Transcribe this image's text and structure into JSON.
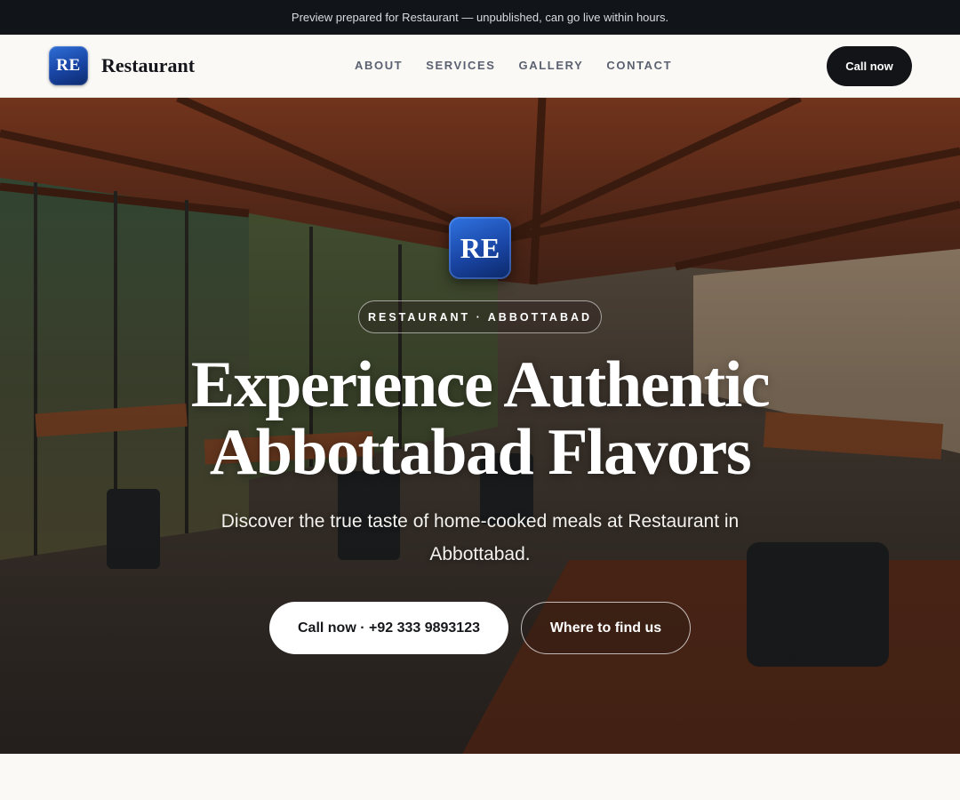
{
  "preview_banner": "Preview prepared for Restaurant — unpublished, can go live within hours.",
  "header": {
    "logo_initials": "RE",
    "brand_name": "Restaurant",
    "nav": [
      "ABOUT",
      "SERVICES",
      "GALLERY",
      "CONTACT"
    ],
    "cta_label": "Call now"
  },
  "hero": {
    "logo_initials": "RE",
    "eyebrow": "RESTAURANT · ABBOTTABAD",
    "title_line1": "Experience Authentic",
    "title_line2": "Abbottabad Flavors",
    "subtitle": "Discover the true taste of home-cooked meals at Restaurant in Abbottabad.",
    "primary_cta": "Call now · +92 333 9893123",
    "secondary_cta": "Where to find us",
    "background_photo": "restaurant-dining-room-photo"
  },
  "colors": {
    "dark": "#111419",
    "brand_blue": "#1a47a8",
    "page_bg": "#faf9f6"
  }
}
